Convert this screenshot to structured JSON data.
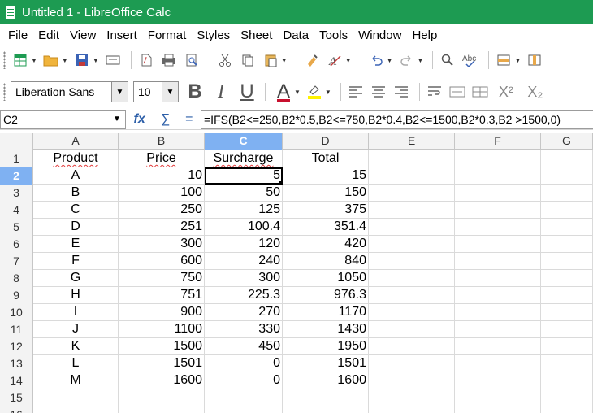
{
  "window": {
    "title": "Untitled 1 - LibreOffice Calc"
  },
  "menu": [
    "File",
    "Edit",
    "View",
    "Insert",
    "Format",
    "Styles",
    "Sheet",
    "Data",
    "Tools",
    "Window",
    "Help"
  ],
  "format_toolbar": {
    "font_name": "Liberation Sans",
    "font_size": "10"
  },
  "formula_bar": {
    "cell_ref": "C2",
    "formula": "=IFS(B2<=250,B2*0.5,B2<=750,B2*0.4,B2<=1500,B2*0.3,B2 >1500,0)"
  },
  "sheet": {
    "columns": [
      "A",
      "B",
      "C",
      "D",
      "E",
      "F",
      "G"
    ],
    "selected_column": "C",
    "selected_row": 2,
    "rows": [
      {
        "num": "1",
        "cells": [
          "Product",
          "Price",
          "Surcharge",
          "Total",
          "",
          "",
          ""
        ]
      },
      {
        "num": "2",
        "cells": [
          "A",
          "10",
          "5",
          "15",
          "",
          "",
          ""
        ]
      },
      {
        "num": "3",
        "cells": [
          "B",
          "100",
          "50",
          "150",
          "",
          "",
          ""
        ]
      },
      {
        "num": "4",
        "cells": [
          "C",
          "250",
          "125",
          "375",
          "",
          "",
          ""
        ]
      },
      {
        "num": "5",
        "cells": [
          "D",
          "251",
          "100.4",
          "351.4",
          "",
          "",
          ""
        ]
      },
      {
        "num": "6",
        "cells": [
          "E",
          "300",
          "120",
          "420",
          "",
          "",
          ""
        ]
      },
      {
        "num": "7",
        "cells": [
          "F",
          "600",
          "240",
          "840",
          "",
          "",
          ""
        ]
      },
      {
        "num": "8",
        "cells": [
          "G",
          "750",
          "300",
          "1050",
          "",
          "",
          ""
        ]
      },
      {
        "num": "9",
        "cells": [
          "H",
          "751",
          "225.3",
          "976.3",
          "",
          "",
          ""
        ]
      },
      {
        "num": "10",
        "cells": [
          "I",
          "900",
          "270",
          "1170",
          "",
          "",
          ""
        ]
      },
      {
        "num": "11",
        "cells": [
          "J",
          "1100",
          "330",
          "1430",
          "",
          "",
          ""
        ]
      },
      {
        "num": "12",
        "cells": [
          "K",
          "1500",
          "450",
          "1950",
          "",
          "",
          ""
        ]
      },
      {
        "num": "13",
        "cells": [
          "L",
          "1501",
          "0",
          "1501",
          "",
          "",
          ""
        ]
      },
      {
        "num": "14",
        "cells": [
          "M",
          "1600",
          "0",
          "1600",
          "",
          "",
          ""
        ]
      },
      {
        "num": "15",
        "cells": [
          "",
          "",
          "",
          "",
          "",
          "",
          ""
        ]
      },
      {
        "num": "16",
        "cells": [
          "",
          "",
          "",
          "",
          "",
          "",
          ""
        ]
      }
    ]
  }
}
